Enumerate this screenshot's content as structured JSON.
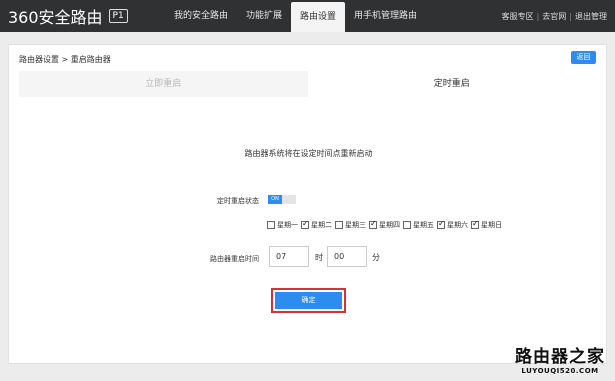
{
  "header": {
    "logo_text": "360安全路由",
    "logo_badge": "P1",
    "nav": [
      {
        "label": "我的安全路由",
        "active": false
      },
      {
        "label": "功能扩展",
        "active": false
      },
      {
        "label": "路由设置",
        "active": true
      },
      {
        "label": "用手机管理路由",
        "active": false
      }
    ],
    "links": [
      "客服专区",
      "去官网",
      "退出管理"
    ]
  },
  "panel": {
    "breadcrumb": "路由器设置 > 重启路由器",
    "back_label": "返回",
    "tabs": [
      {
        "label": "立即重启",
        "active": false
      },
      {
        "label": "定时重启",
        "active": true
      }
    ],
    "description": "路由器系统将在设定时间点重新启动",
    "schedule_label": "定时重启状态",
    "toggle_label": "ON",
    "toggle_state": "on",
    "days": [
      {
        "label": "星期一",
        "checked": false
      },
      {
        "label": "星期二",
        "checked": true
      },
      {
        "label": "星期三",
        "checked": false
      },
      {
        "label": "星期四",
        "checked": true
      },
      {
        "label": "星期五",
        "checked": false
      },
      {
        "label": "星期六",
        "checked": true
      },
      {
        "label": "星期日",
        "checked": true
      }
    ],
    "time_label": "路由器重启时间",
    "hour_value": "07",
    "hour_unit": "时",
    "minute_value": "00",
    "minute_unit": "分",
    "confirm_label": "确定"
  },
  "watermark": {
    "main": "路由器之家",
    "sub": "LUYOUQI520.COM"
  },
  "colors": {
    "topbar": "#2f3133",
    "accent": "#2d8cf0",
    "highlight_border": "#d0333a"
  }
}
